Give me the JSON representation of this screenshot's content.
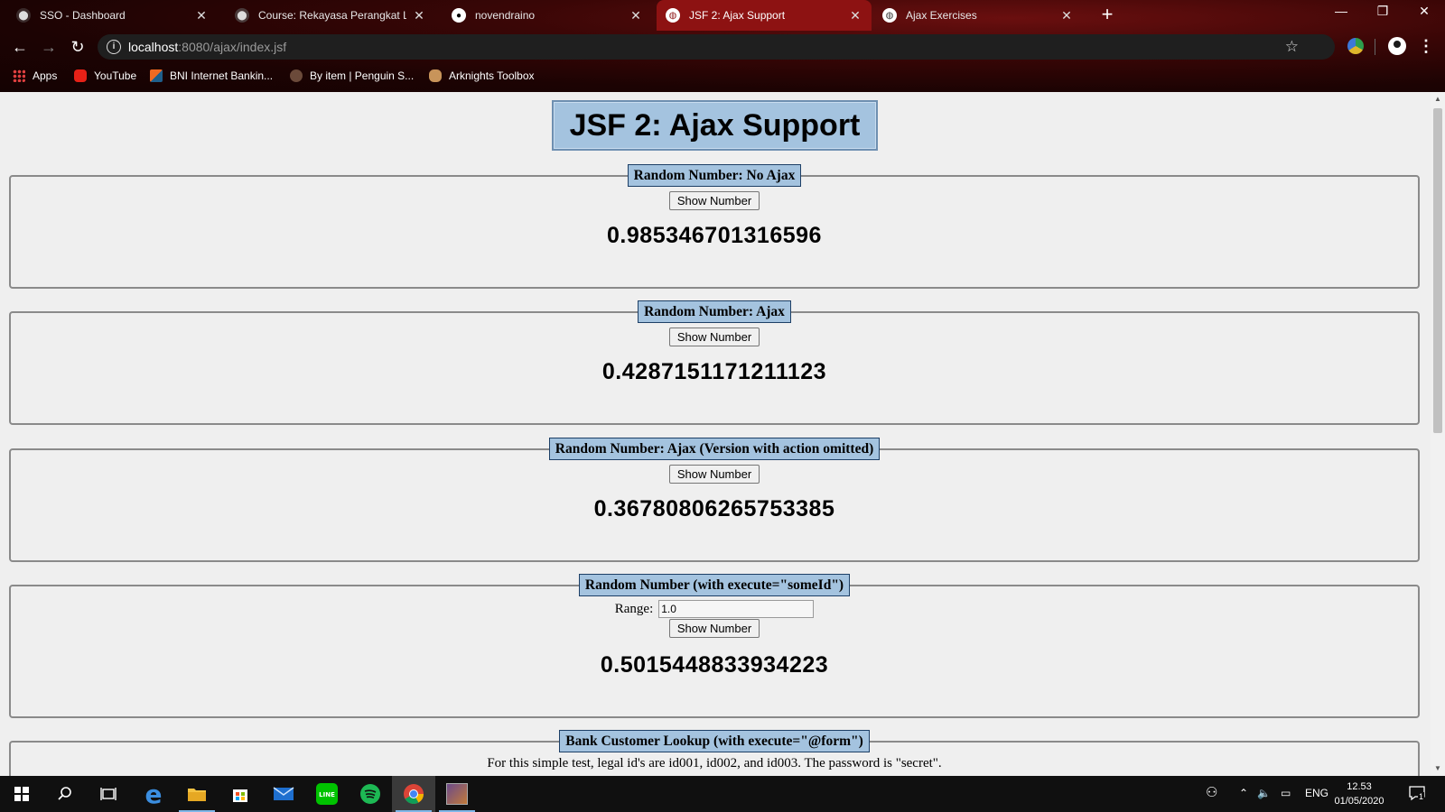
{
  "browser": {
    "tabs": [
      {
        "title": "SSO - Dashboard",
        "icon": "shield-favicon"
      },
      {
        "title": "Course: Rekayasa Perangkat Lunak",
        "icon": "course-favicon"
      },
      {
        "title": "novendraino",
        "icon": "github-favicon"
      },
      {
        "title": "JSF 2: Ajax Support",
        "icon": "globe-favicon",
        "active": true
      },
      {
        "title": "Ajax Exercises",
        "icon": "globe-favicon"
      }
    ],
    "tab_close_glyph": "✕",
    "new_tab_glyph": "+",
    "url_host": "localhost",
    "url_path": ":8080/ajax/index.jsf",
    "bookmarks": [
      {
        "label": "Apps",
        "icon": "apps-grid-icon"
      },
      {
        "label": "YouTube",
        "icon": "youtube-icon"
      },
      {
        "label": "BNI Internet Bankin...",
        "icon": "bni-icon"
      },
      {
        "label": "By item | Penguin S...",
        "icon": "penguin-icon"
      },
      {
        "label": "Arknights Toolbox",
        "icon": "arknights-icon"
      }
    ],
    "accent_color": "#8d1212"
  },
  "page": {
    "title": "JSF 2: Ajax Support",
    "sections": [
      {
        "legend": "Random Number: No Ajax",
        "button": "Show Number",
        "result": "0.985346701316596"
      },
      {
        "legend": "Random Number: Ajax",
        "button": "Show Number",
        "result": "0.4287151171211123"
      },
      {
        "legend": "Random Number: Ajax (Version with action omitted)",
        "button": "Show Number",
        "result": "0.36780806265753385"
      },
      {
        "legend": "Random Number (with execute=\"someId\")",
        "range_label": "Range:",
        "range_value": "1.0",
        "button": "Show Number",
        "result": "0.5015448833934223"
      },
      {
        "legend": "Bank Customer Lookup (with execute=\"@form\")",
        "description": "For this simple test, legal id's are id001, id002, and id003. The password is \"secret\"."
      }
    ]
  },
  "taskbar": {
    "language": "ENG",
    "time": "12.53",
    "date": "01/05/2020",
    "notification_count": "1"
  }
}
